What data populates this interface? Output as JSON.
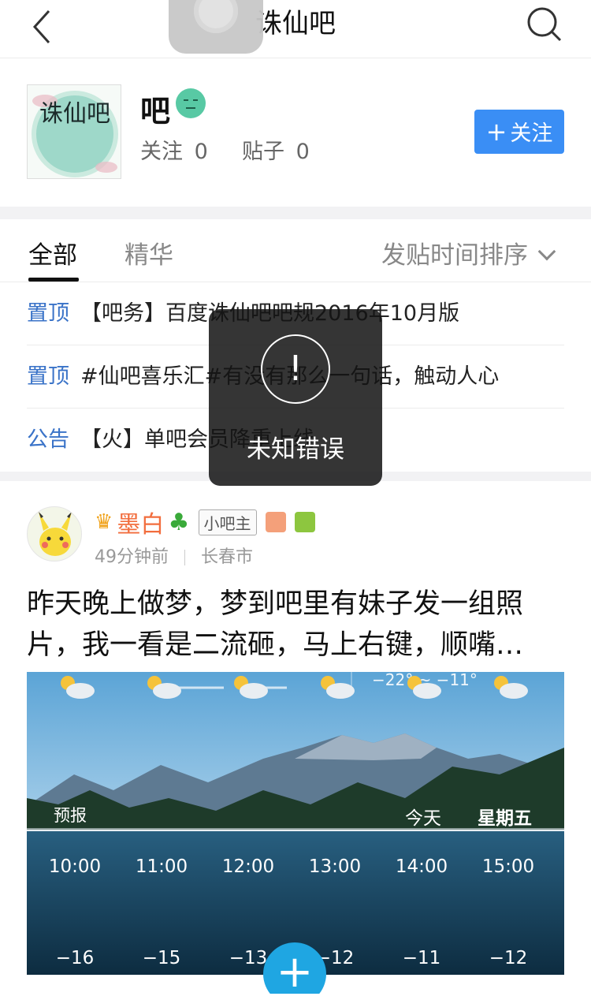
{
  "header": {
    "title": "诛仙吧",
    "back_icon": "chevron-left-icon",
    "search_icon": "search-icon"
  },
  "forum": {
    "name": "吧",
    "avatar_text": "诛仙吧",
    "follow_label": "关注",
    "follow_count": "0",
    "posts_label": "贴子",
    "posts_count": "0",
    "follow_button": "关注"
  },
  "tabs": {
    "all": "全部",
    "featured": "精华",
    "sort_label": "发贴时间排序"
  },
  "pinned": [
    {
      "tag": "置顶",
      "text": "【吧务】百度诛仙吧吧规2016年10月版"
    },
    {
      "tag": "置顶",
      "text": "#仙吧喜乐汇#有没有那么一句话，触动人心"
    },
    {
      "tag": "公告",
      "text": "【火】单吧会员降重上线"
    }
  ],
  "toast": {
    "message": "未知错误"
  },
  "post": {
    "username": "墨白",
    "role": "小吧主",
    "time": "49分钟前",
    "location": "长春市",
    "text_line1": "昨天晚上做梦，梦到吧里有妹子发一组照",
    "text_line2": "片，我一看是二流砸，马上右键，顺嘴…",
    "image": {
      "temp_range": "−22° ~ −11°",
      "forecast_label": "预报",
      "today_label": "今天",
      "weekday_label": "星期五",
      "hours": [
        "10:00",
        "11:00",
        "12:00",
        "13:00",
        "14:00",
        "15:00"
      ],
      "temps": [
        "−16",
        "−15",
        "−13",
        "−12",
        "−11",
        "−12"
      ]
    }
  },
  "colors": {
    "accent": "#3a8ef5",
    "tag_blue": "#3a73c8",
    "username": "#f26d3d",
    "fab": "#1fa6e2"
  }
}
